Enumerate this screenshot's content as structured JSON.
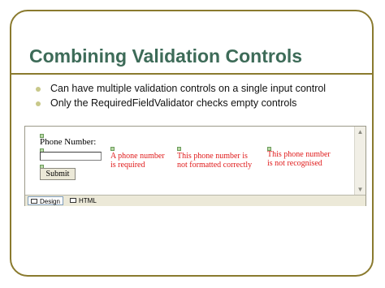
{
  "slide": {
    "title": "Combining Validation Controls",
    "bullets": [
      "Can have multiple validation controls on a single input control",
      "Only the RequiredFieldValidator checks empty controls"
    ]
  },
  "designer": {
    "form": {
      "phone_label": "Phone Number:",
      "phone_value": "",
      "submit_label": "Submit"
    },
    "validators": [
      "A phone number\nis required",
      "This phone number is\nnot formatted correctly",
      "This phone number\nis not recognised"
    ],
    "tabs": [
      {
        "label": "Design",
        "active": true
      },
      {
        "label": "HTML",
        "active": false
      }
    ]
  },
  "colors": {
    "title": "#3d6b58",
    "frame": "#8a7a2e",
    "validator_text": "#e01b1b"
  }
}
